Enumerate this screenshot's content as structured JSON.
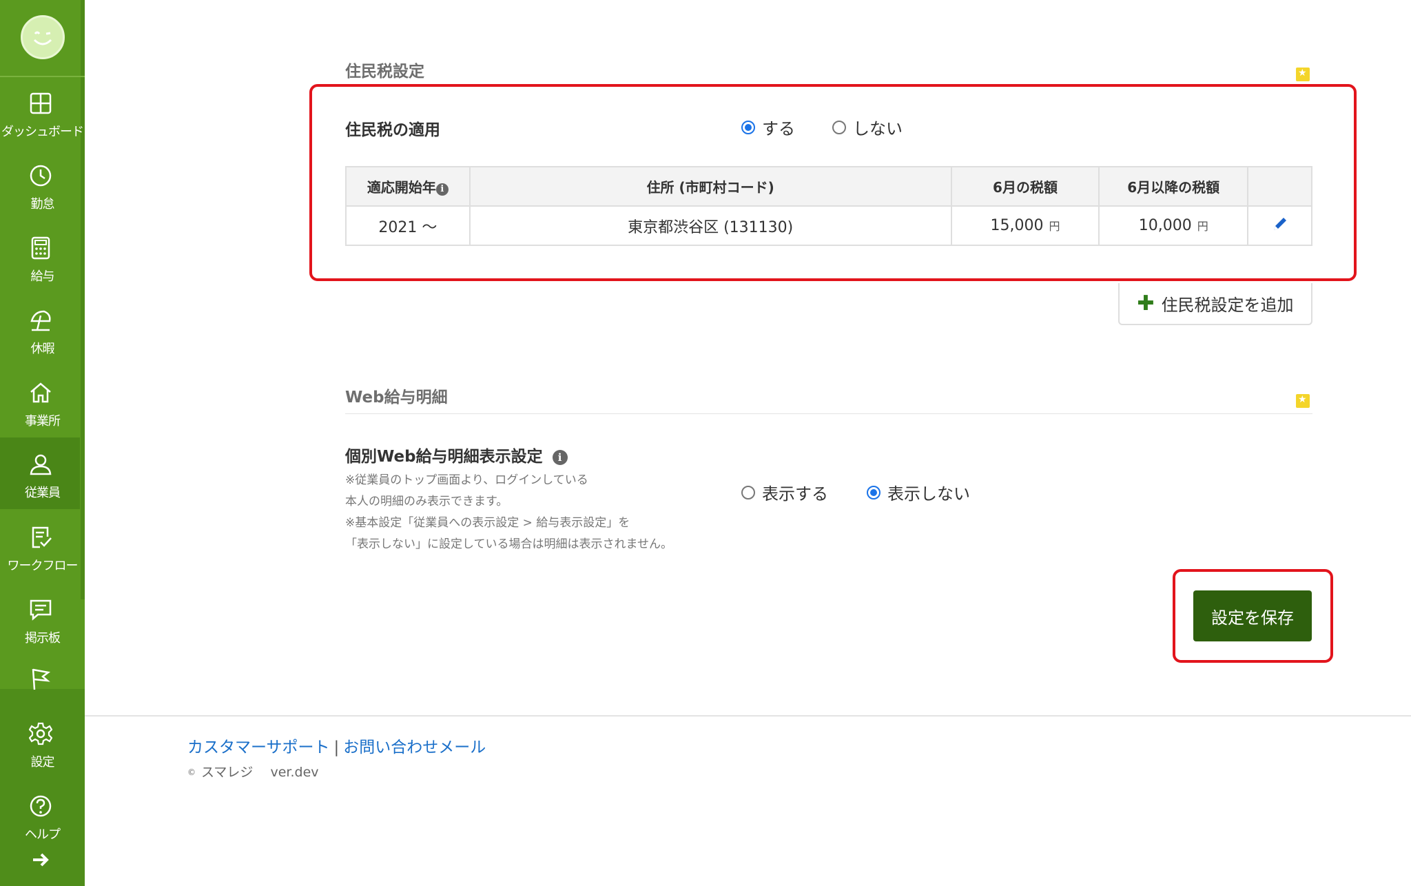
{
  "sidebar": {
    "items": [
      {
        "label": "ダッシュボード",
        "icon": "dashboard-icon"
      },
      {
        "label": "勤怠",
        "icon": "clock-icon"
      },
      {
        "label": "給与",
        "icon": "calculator-icon"
      },
      {
        "label": "休暇",
        "icon": "beach-umbrella-icon"
      },
      {
        "label": "事業所",
        "icon": "home-icon"
      },
      {
        "label": "従業員",
        "icon": "person-icon",
        "active": true
      },
      {
        "label": "ワークフロー",
        "icon": "checklist-icon"
      },
      {
        "label": "掲示板",
        "icon": "message-board-icon"
      },
      {
        "label": "",
        "icon": "flag-icon"
      },
      {
        "label": "設定",
        "icon": "gear-icon"
      },
      {
        "label": "ヘルプ",
        "icon": "help-icon"
      }
    ],
    "expand_icon": "arrow-right-icon"
  },
  "resident_tax": {
    "section_title": "住民税設定",
    "apply_label": "住民税の適用",
    "options": [
      "する",
      "しない"
    ],
    "selected": "する",
    "table": {
      "headers": [
        "適応開始年",
        "住所 (市町村コード)",
        "6月の税額",
        "6月以降の税額",
        ""
      ],
      "rows": [
        {
          "start_year": "2021 〜",
          "address": "東京都渋谷区 (131130)",
          "june_tax": "15,000",
          "after_june_tax": "10,000",
          "unit": "円"
        }
      ]
    },
    "add_button": "住民税設定を追加"
  },
  "web_payslip": {
    "section_title": "Web給与明細",
    "setting_label": "個別Web給与明細表示設定",
    "notes": [
      "※従業員のトップ画面より、ログインしている",
      "本人の明細のみ表示できます。",
      "※基本設定「従業員への表示設定 > 給与表示設定」を",
      "「表示しない」に設定している場合は明細は表示されません。"
    ],
    "options": [
      "表示する",
      "表示しない"
    ],
    "selected": "表示しない"
  },
  "save_button": "設定を保存",
  "footer": {
    "support_link": "カスタマーサポート",
    "separator": "|",
    "contact_link": "お問い合わせメール",
    "copyright_symbol": "©",
    "copyright": "スマレジ　 ver.dev"
  },
  "colors": {
    "sidebar": "#5b9a1f",
    "save_button": "#2e5f0d",
    "highlight_box": "#e2141c",
    "link": "#1a6fc9"
  }
}
